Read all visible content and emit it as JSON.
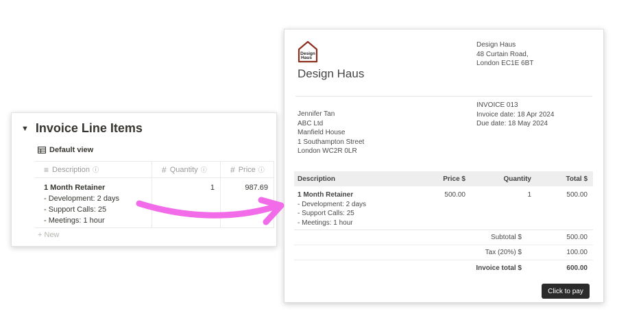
{
  "database": {
    "title": "Invoice Line Items",
    "view_label": "Default view",
    "columns": {
      "description": "Description",
      "quantity": "Quantity",
      "price": "Price"
    },
    "row": {
      "title": "1 Month Retainer",
      "lines": [
        "- Development: 2 days",
        "- Support Calls: 25",
        "- Meetings: 1 hour"
      ],
      "quantity": "1",
      "price": "987.69"
    },
    "new_label": "New"
  },
  "invoice": {
    "logo_text": [
      "Design",
      "Haus"
    ],
    "logo_color": "#8b2e1d",
    "company_name": "Design Haus",
    "from_address": [
      "Design Haus",
      "48 Curtain Road,",
      "London EC1E 6BT"
    ],
    "bill_to": [
      "Jennifer Tan",
      "ABC Ltd",
      "Manfield House",
      "1 Southampton Street",
      "London WC2R 0LR"
    ],
    "number": "INVOICE 013",
    "invoice_date": "Invoice date: 18 Apr 2024",
    "due_date": "Due date: 18 May 2024",
    "table_headers": {
      "description": "Description",
      "price": "Price $",
      "quantity": "Quantity",
      "total": "Total $"
    },
    "line": {
      "title": "1 Month Retainer",
      "details": [
        "- Development: 2 days",
        "- Support Calls: 25",
        "- Meetings: 1 hour"
      ],
      "price": "500.00",
      "quantity": "1",
      "total": "500.00"
    },
    "subtotal_label": "Subtotal $",
    "subtotal_value": "500.00",
    "tax_label": "Tax (20%) $",
    "tax_value": "100.00",
    "total_label": "Invoice total $",
    "total_value": "600.00",
    "pay_button": "Click to pay"
  },
  "arrow_color": "#f26be8"
}
